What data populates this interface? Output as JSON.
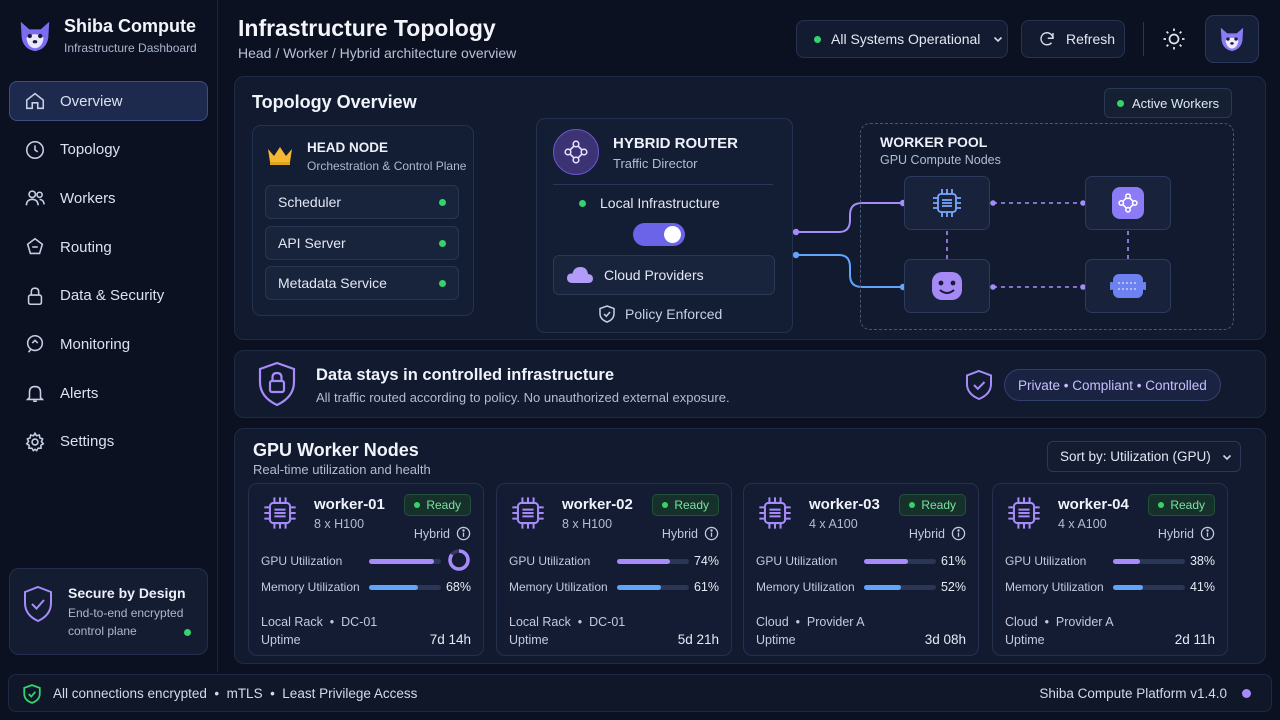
{
  "brand": {
    "title": "Shiba Compute",
    "subtitle": "Infrastructure Dashboard"
  },
  "nav": [
    {
      "label": "Overview",
      "icon": "home-icon",
      "active": true
    },
    {
      "label": "Topology",
      "icon": "clock-icon"
    },
    {
      "label": "Workers",
      "icon": "users-icon"
    },
    {
      "label": "Routing",
      "icon": "routing-icon"
    },
    {
      "label": "Data & Security",
      "icon": "lock-icon"
    },
    {
      "label": "Monitoring",
      "icon": "monitoring-icon"
    },
    {
      "label": "Alerts",
      "icon": "bell-icon"
    },
    {
      "label": "Settings",
      "icon": "gear-icon"
    }
  ],
  "secure_card": {
    "title": "Secure by Design",
    "text_line1": "End-to-end encrypted",
    "text_line2": "control plane"
  },
  "header": {
    "title": "Infrastructure Topology",
    "subtitle": "Head / Worker / Hybrid architecture overview",
    "status_label": "All Systems Operational",
    "refresh_label": "Refresh"
  },
  "topology": {
    "title": "Topology Overview",
    "active_workers_label": "Active Workers",
    "head_node": {
      "title": "HEAD NODE",
      "subtitle": "Orchestration & Control Plane",
      "services": [
        "Scheduler",
        "API Server",
        "Metadata Service"
      ]
    },
    "router": {
      "title": "HYBRID ROUTER",
      "subtitle": "Traffic Director",
      "local_label": "Local Infrastructure",
      "cloud_label": "Cloud Providers",
      "policy_label": "Policy Enforced",
      "toggle_on": true
    },
    "worker_pool": {
      "title": "WORKER POOL",
      "subtitle": "GPU Compute Nodes"
    }
  },
  "security_banner": {
    "title": "Data stays in controlled infrastructure",
    "text": "All traffic routed according to policy. No unauthorized external exposure.",
    "badge": "Private • Compliant • Controlled"
  },
  "gpu_section": {
    "title": "GPU Worker Nodes",
    "subtitle": "Real-time utilization and health",
    "sort_label": "Sort by: Utilization (GPU)"
  },
  "labels": {
    "gpu_util": "GPU Utilization",
    "mem_util": "Memory Utilization",
    "uptime": "Uptime"
  },
  "workers": [
    {
      "name": "worker-01",
      "spec": "8 x H100",
      "status": "Ready",
      "mode": "Hybrid",
      "gpu": "",
      "gpu_value": 0.9,
      "mem": "68%",
      "mem_value": 0.68,
      "location": "Local Rack  •  DC-01",
      "uptime": "7d 14h"
    },
    {
      "name": "worker-02",
      "spec": "8 x H100",
      "status": "Ready",
      "mode": "Hybrid",
      "gpu": "74%",
      "gpu_value": 0.74,
      "mem": "61%",
      "mem_value": 0.61,
      "location": "Local Rack  •  DC-01",
      "uptime": "5d 21h"
    },
    {
      "name": "worker-03",
      "spec": "4 x A100",
      "status": "Ready",
      "mode": "Hybrid",
      "gpu": "61%",
      "gpu_value": 0.61,
      "mem": "52%",
      "mem_value": 0.52,
      "location": "Cloud  •  Provider A",
      "uptime": "3d 08h"
    },
    {
      "name": "worker-04",
      "spec": "4 x A100",
      "status": "Ready",
      "mode": "Hybrid",
      "gpu": "38%",
      "gpu_value": 0.38,
      "mem": "41%",
      "mem_value": 0.41,
      "location": "Cloud  •  Provider A",
      "uptime": "2d 11h"
    }
  ],
  "footer": {
    "left": "All connections encrypted  •  mTLS  •  Least Privilege Access",
    "right": "Shiba Compute Platform v1.4.0"
  },
  "colors": {
    "accent": "#a78bfa",
    "blue": "#60a5fa",
    "ok": "#34d36b",
    "bg": "#0b1120"
  }
}
